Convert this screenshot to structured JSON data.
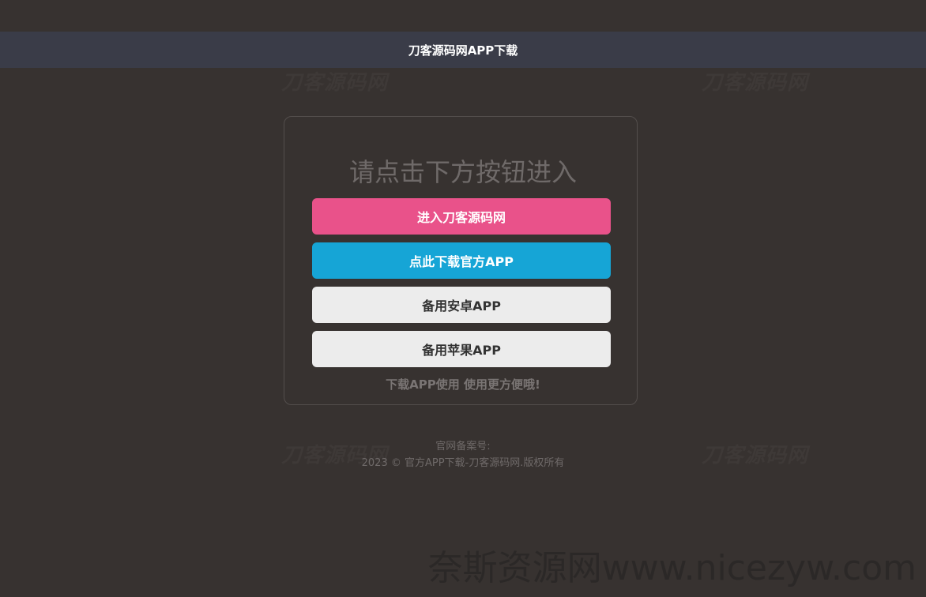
{
  "header": {
    "title": "刀客源码网APP下载"
  },
  "watermarks": [
    "刀客源码网",
    "刀客源码网",
    "刀客源码网",
    "刀客源码网"
  ],
  "main": {
    "heading": "请点击下方按钮进入",
    "buttons": {
      "enter": "进入刀客源码网",
      "download": "点此下载官方APP",
      "android": "备用安卓APP",
      "ios": "备用苹果APP"
    },
    "tip": "下载APP使用 使用更方便哦!"
  },
  "footer": {
    "icp": "官网备案号:",
    "copyright": "2023 © 官方APP下载-刀客源码网.版权所有"
  },
  "overlay_watermark": "奈斯资源网www.nicezyw.com",
  "colors": {
    "background": "#373230",
    "header": "#3a3c48",
    "enter_button": "#e9528a",
    "download_button": "#16a5d6",
    "secondary_button": "#ececec"
  }
}
